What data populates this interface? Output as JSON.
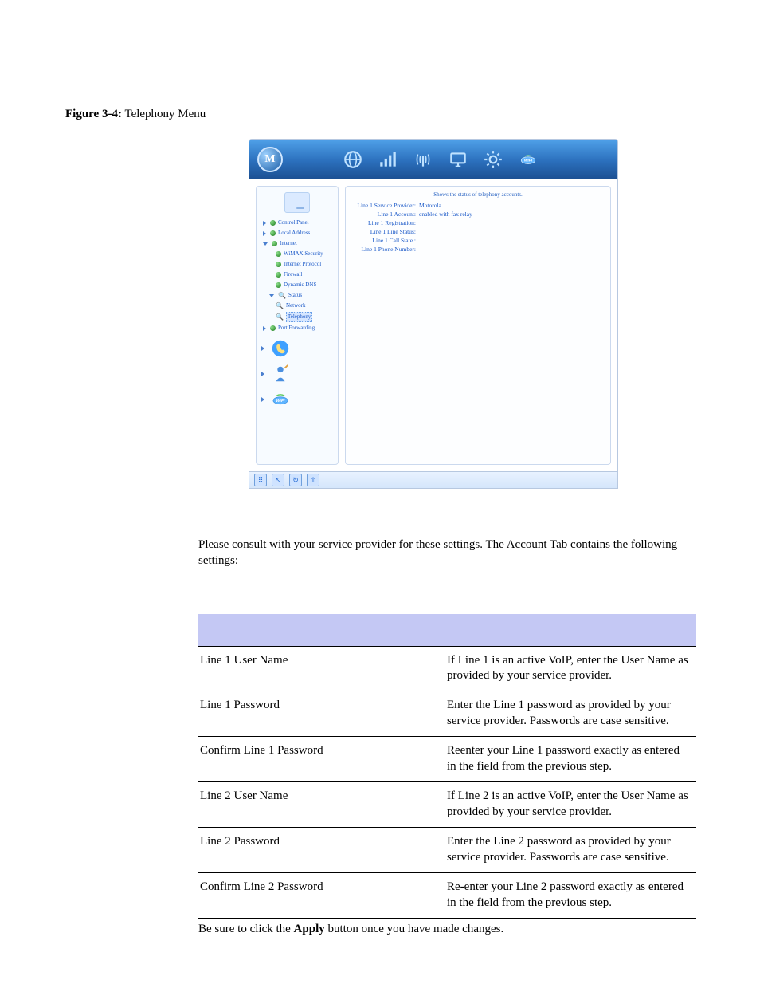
{
  "figure_label": "Figure 3-4:",
  "figure_title": "Telephony Menu",
  "screenshot": {
    "logo_letter": "M",
    "header_icons": [
      "globe-icon",
      "signal-icon",
      "antenna-icon",
      "monitor-icon",
      "gear-icon",
      "wifi-icon"
    ],
    "sidebar": {
      "items": [
        {
          "icon": "tri",
          "label": "Control Panel",
          "indent": 0,
          "dot": "g"
        },
        {
          "icon": "tri",
          "label": "Local Address",
          "indent": 0,
          "dot": "g"
        },
        {
          "icon": "tri-open",
          "label": "Internet",
          "indent": 0,
          "dot": "g"
        },
        {
          "icon": "",
          "label": "WiMAX Security",
          "indent": 2,
          "dot": "g"
        },
        {
          "icon": "",
          "label": "Internet Protocol",
          "indent": 2,
          "dot": "g"
        },
        {
          "icon": "",
          "label": "Firewall",
          "indent": 2,
          "dot": "g"
        },
        {
          "icon": "",
          "label": "Dynamic DNS",
          "indent": 2,
          "dot": "g"
        },
        {
          "icon": "tri-open",
          "label": "Status",
          "indent": 1,
          "dot": "mag"
        },
        {
          "icon": "",
          "label": "Network",
          "indent": 2,
          "dot": "mag"
        },
        {
          "icon": "",
          "label": "Telephony",
          "indent": 2,
          "dot": "mag",
          "active": true
        },
        {
          "icon": "tri",
          "label": "Port Forwarding",
          "indent": 0,
          "dot": "g"
        }
      ]
    },
    "main": {
      "status_text": "Shows the status of telephony accounts.",
      "rows": [
        {
          "k": "Line 1 Service Provider:",
          "v": "Motorola"
        },
        {
          "k": "Line 1 Account:",
          "v": "enabled with fax relay"
        },
        {
          "k": "Line 1 Registration:",
          "v": ""
        },
        {
          "k": "Line 1 Line Status:",
          "v": ""
        },
        {
          "k": "Line 1 Call State :",
          "v": ""
        },
        {
          "k": "Line 1 Phone Number:",
          "v": ""
        }
      ]
    },
    "footer_icons": [
      "grid-icon",
      "arrow-nw-icon",
      "refresh-icon",
      "arrow-up-icon"
    ]
  },
  "paragraph": "Please consult with your service provider for these settings. The Account Tab contains the following settings:",
  "table": [
    {
      "name": "Line 1 User Name",
      "desc": "If Line 1 is an active VoIP, enter the User Name as provided by your service provider."
    },
    {
      "name": "Line 1 Password",
      "desc": "Enter the Line 1 password as provided by your service provider. Passwords are case sensitive."
    },
    {
      "name": "Confirm Line 1 Password",
      "desc": "Reenter your Line 1 password exactly as entered in the field from the previous step."
    },
    {
      "name": "Line 2 User Name",
      "desc": "If Line 2 is an active VoIP, enter the User Name as provided by your service provider."
    },
    {
      "name": "Line 2 Password",
      "desc": "Enter the Line 2 password as provided by your service provider. Passwords are case sensitive."
    },
    {
      "name": "Confirm Line 2 Password",
      "desc": "Re-enter your Line 2 password exactly as entered in the field from the previous step."
    }
  ],
  "note_pre": "Be sure to click the ",
  "note_bold": "Apply",
  "note_post": " button once you have made changes."
}
